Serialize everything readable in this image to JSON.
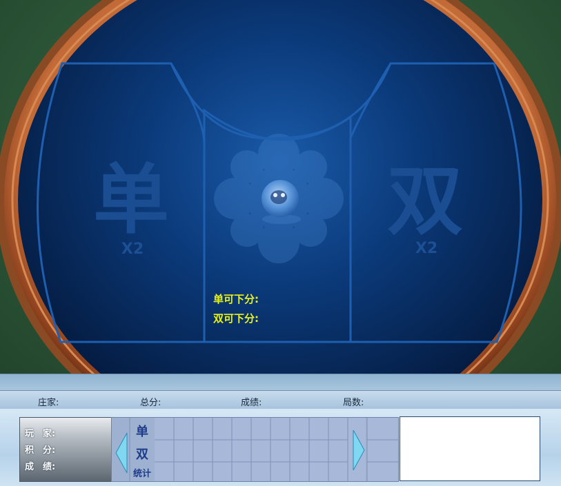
{
  "table": {
    "odd_char": "单",
    "even_char": "双",
    "odd_multiplier": "X2",
    "even_multiplier": "X2",
    "odd_limit_label": "单可下分:",
    "even_limit_label": "双可下分:"
  },
  "info_bar": {
    "banker_label": "庄家:",
    "total_label": "总分:",
    "score_label": "成绩:",
    "rounds_label": "局数:"
  },
  "player_panel": {
    "player_label": "玩　家:",
    "points_label": "积　分:",
    "result_label": "成　绩:"
  },
  "road": {
    "row_odd": "单",
    "row_even": "双",
    "row_stats": "统计"
  },
  "colors": {
    "limit_text": "#e8f21a",
    "table_blue": "#0d3a78",
    "rim_brown": "#a4582f"
  }
}
